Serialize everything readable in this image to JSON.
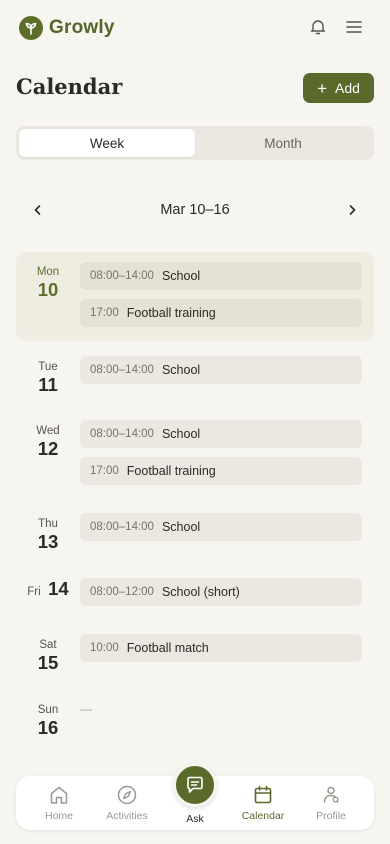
{
  "app": {
    "name": "Growly"
  },
  "header": {
    "bell_icon": "bell-icon",
    "menu_icon": "hamburger-menu-icon"
  },
  "page": {
    "title": "Calendar",
    "add_label": "Add"
  },
  "view_toggle": {
    "options": [
      "Week",
      "Month"
    ],
    "selected": "Week"
  },
  "week": {
    "label": "Mar 10–16"
  },
  "days": [
    {
      "name": "Mon",
      "num": "10",
      "today": true,
      "events": [
        {
          "time": "08:00–14:00",
          "title": "School"
        },
        {
          "time": "17:00",
          "title": "Football training"
        }
      ]
    },
    {
      "name": "Tue",
      "num": "11",
      "events": [
        {
          "time": "08:00–14:00",
          "title": "School"
        }
      ]
    },
    {
      "name": "Wed",
      "num": "12",
      "events": [
        {
          "time": "08:00–14:00",
          "title": "School"
        },
        {
          "time": "17:00",
          "title": "Football training"
        }
      ]
    },
    {
      "name": "Thu",
      "num": "13",
      "events": [
        {
          "time": "08:00–14:00",
          "title": "School"
        }
      ]
    },
    {
      "name": "Fri",
      "num": "14",
      "events": [
        {
          "time": "08:00–12:00",
          "title": "School (short)"
        }
      ]
    },
    {
      "name": "Sat",
      "num": "15",
      "events": [
        {
          "time": "10:00",
          "title": "Football match"
        }
      ]
    },
    {
      "name": "Sun",
      "num": "16",
      "empty_text": "—",
      "events": []
    }
  ],
  "bottom_nav": [
    {
      "label": "Home",
      "icon": "home-icon"
    },
    {
      "label": "Activities",
      "icon": "compass-icon"
    },
    {
      "label": "Ask",
      "icon": "chat-icon"
    },
    {
      "label": "Calendar",
      "icon": "calendar-icon",
      "active": true
    },
    {
      "label": "Profile",
      "icon": "profile-icon"
    }
  ],
  "colors": {
    "accent": "#5a6a2a",
    "background": "#f7f5f0",
    "event_bg": "#ebe7e1",
    "today_bg": "#efede2"
  }
}
